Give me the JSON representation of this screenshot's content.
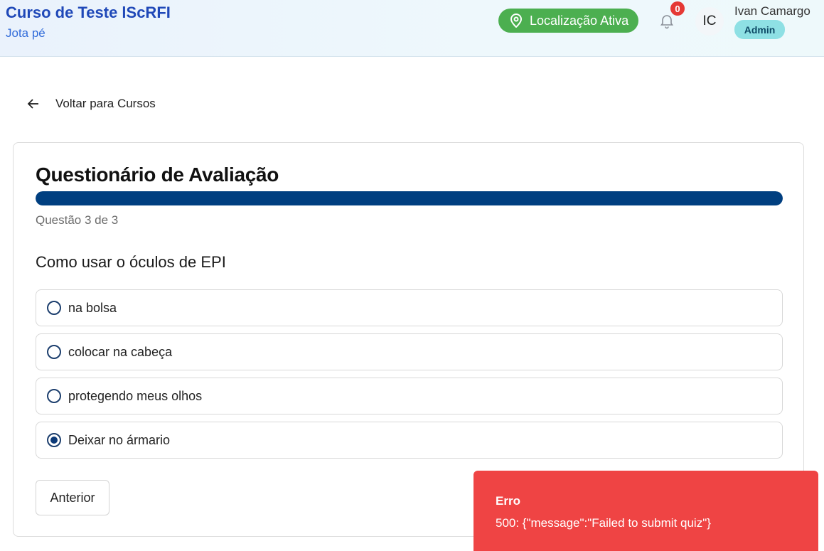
{
  "header": {
    "course_title": "Curso de Teste lScRFI",
    "course_subtitle": "Jota pé",
    "location_label": "Localização Ativa",
    "location_icon": "map-pin-icon",
    "notifications_icon": "bell-icon",
    "notifications_count": "0",
    "user": {
      "initials": "IC",
      "name": "Ivan Camargo",
      "role": "Admin"
    }
  },
  "nav": {
    "back_icon": "arrow-left-icon",
    "back_label": "Voltar para Cursos"
  },
  "quiz": {
    "title": "Questionário de Avaliação",
    "progress_fraction": 1.0,
    "progress_label": "Questão 3 de 3",
    "question": "Como usar o óculos de EPI",
    "options": [
      {
        "label": "na bolsa",
        "selected": false
      },
      {
        "label": "colocar na cabeça",
        "selected": false
      },
      {
        "label": "protegendo meus olhos",
        "selected": false
      },
      {
        "label": "Deixar no ármario",
        "selected": true
      }
    ],
    "prev_button_label": "Anterior"
  },
  "toast": {
    "title": "Erro",
    "message": "500: {\"message\":\"Failed to submit quiz\"}"
  },
  "colors": {
    "brand": "#1f48b8",
    "location_green": "#4caf50",
    "progress": "#003f80",
    "error": "#ef4444",
    "badge_red": "#e53935",
    "role_badge": "#8ee0e4"
  }
}
